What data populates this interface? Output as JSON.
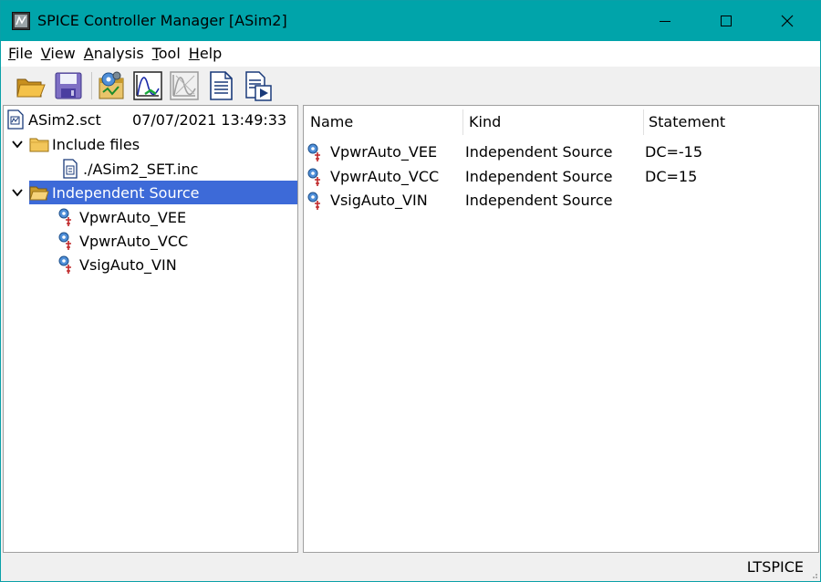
{
  "window": {
    "title": "SPICE Controller Manager [ASim2]"
  },
  "menu": [
    {
      "accel": "F",
      "rest": "ile"
    },
    {
      "accel": "V",
      "rest": "iew"
    },
    {
      "accel": "A",
      "rest": "nalysis"
    },
    {
      "accel": "T",
      "rest": "ool"
    },
    {
      "accel": "H",
      "rest": "elp"
    }
  ],
  "toolbar": {
    "buttons": [
      "open-folder-icon",
      "save-disk-icon",
      "run-gear-icon",
      "waveform-icon",
      "waveform-disabled-icon",
      "document-icon",
      "play-document-icon"
    ]
  },
  "tree": {
    "root": {
      "name": "ASim2.sct",
      "timestamp": "07/07/2021 13:49:33"
    },
    "include": {
      "label": "Include files",
      "children": [
        "./ASim2_SET.inc"
      ]
    },
    "sources": {
      "label": "Independent Source",
      "children": [
        "VpwrAuto_VEE",
        "VpwrAuto_VCC",
        "VsigAuto_VIN"
      ]
    }
  },
  "list": {
    "columns": [
      "Name",
      "Kind",
      "Statement"
    ],
    "rows": [
      {
        "name": "VpwrAuto_VEE",
        "kind": "Independent Source",
        "statement": "DC=-15"
      },
      {
        "name": "VpwrAuto_VCC",
        "kind": "Independent Source",
        "statement": "DC=15"
      },
      {
        "name": "VsigAuto_VIN",
        "kind": "Independent Source",
        "statement": ""
      }
    ]
  },
  "status": {
    "text": "LTSPICE"
  },
  "colors": {
    "titlebar": "#00a4aa",
    "selection": "#3d6ad8"
  }
}
